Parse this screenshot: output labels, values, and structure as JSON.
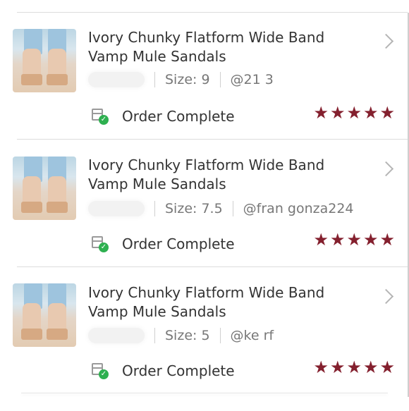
{
  "orders": [
    {
      "title": "Ivory Chunky Flatform Wide Band Vamp Mule Sandals",
      "size": "Size: 9",
      "user": "@21   3",
      "status": "Order Complete",
      "rating": 5,
      "chevron_icon": "chevron-right-icon",
      "status_icon": "box-check-icon"
    },
    {
      "title": "Ivory Chunky Flatform Wide Band Vamp Mule Sandals",
      "size": "Size: 7.5",
      "user": "@fran   gonza224",
      "status": "Order Complete",
      "rating": 5,
      "chevron_icon": "chevron-right-icon",
      "status_icon": "box-check-icon"
    },
    {
      "title": "Ivory Chunky Flatform Wide Band Vamp Mule Sandals",
      "size": "Size: 5",
      "user": "@ke  rf",
      "status": "Order Complete",
      "rating": 5,
      "chevron_icon": "chevron-right-icon",
      "status_icon": "box-check-icon"
    }
  ],
  "colors": {
    "star": "#84202e",
    "check": "#2eb050",
    "text": "#333333",
    "meta": "#777777"
  }
}
